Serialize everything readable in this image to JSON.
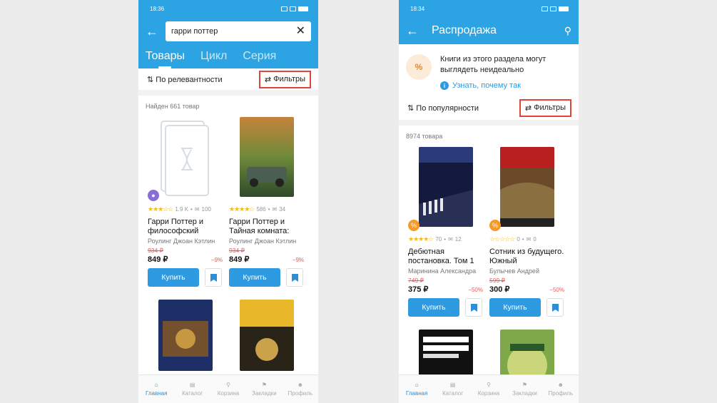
{
  "left": {
    "status_time": "18:36",
    "search_query": "гарри поттер",
    "tabs": [
      "Товары",
      "Цикл",
      "Серия"
    ],
    "sort_label": "По релевантности",
    "filter_label": "Фильтры",
    "found_text": "Найден 661 товар",
    "books": [
      {
        "rating_count": "1.9 K",
        "reviews": "100",
        "title": "Гарри Поттер и философский",
        "author": "Роулинг Джоан Кэтлин",
        "old_price": "934 ₽",
        "price": "849 ₽",
        "discount": "−9%",
        "buy": "Купить",
        "stars_fill": 3
      },
      {
        "rating_count": "586",
        "reviews": "34",
        "title": "Гарри Поттер и Тайная комната:",
        "author": "Роулинг Джоан Кэтлин",
        "old_price": "934 ₽",
        "price": "849 ₽",
        "discount": "−9%",
        "buy": "Купить",
        "stars_fill": 4
      }
    ]
  },
  "right": {
    "status_time": "18:34",
    "title": "Распродажа",
    "notice_text": "Книги из этого раздела могут выглядеть неидеально",
    "notice_link": "Узнать, почему так",
    "sort_label": "По популярности",
    "filter_label": "Фильтры",
    "found_text": "8974 товара",
    "books": [
      {
        "rating_count": "70",
        "reviews": "12",
        "title": "Дебютная постановка. Том 1",
        "author": "Маринина Александра",
        "old_price": "749 ₽",
        "price": "375 ₽",
        "discount": "−50%",
        "buy": "Купить",
        "stars_fill": 4
      },
      {
        "rating_count": "0",
        "reviews": "0",
        "title": "Сотник из будущего. Южный",
        "author": "Булычев Андрей",
        "old_price": "599 ₽",
        "price": "300 ₽",
        "discount": "−50%",
        "buy": "Купить",
        "stars_fill": 0
      }
    ]
  },
  "nav": [
    "Главная",
    "Каталог",
    "Корзина",
    "Закладки",
    "Профиль"
  ],
  "colors": {
    "primary": "#2ca4e4",
    "highlight": "#e0453a",
    "button": "#2d9ae2"
  }
}
